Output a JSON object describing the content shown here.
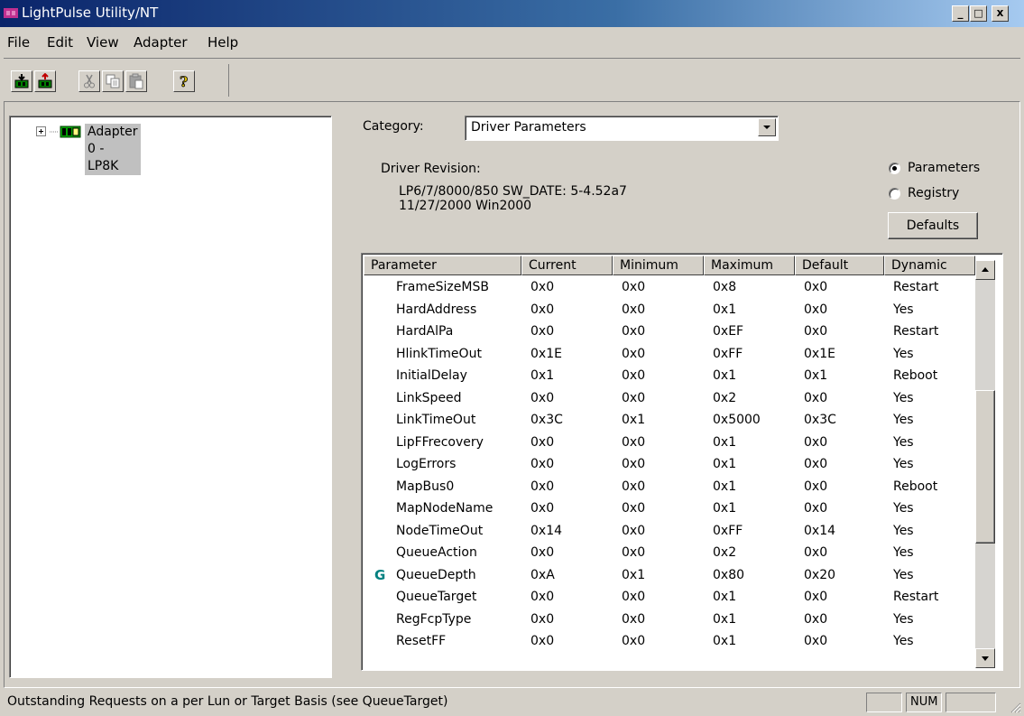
{
  "window": {
    "title": "LightPulse Utility/NT",
    "min": "_",
    "max": "□",
    "close": "x"
  },
  "menu": [
    "File",
    "Edit",
    "View",
    "Adapter",
    "Help"
  ],
  "toolbar": {
    "help_glyph": "?"
  },
  "tree": {
    "label": "Adapter 0 - LP8K"
  },
  "category": {
    "label": "Category:",
    "value": "Driver Parameters"
  },
  "driver": {
    "revision_label": "Driver Revision:",
    "line1": "LP6/7/8000/850 SW_DATE: 5-4.52a7",
    "line2": "11/27/2000 Win2000"
  },
  "options": {
    "parameters_label": "Parameters",
    "registry_label": "Registry",
    "selected": "parameters",
    "defaults_label": "Defaults"
  },
  "table": {
    "columns": [
      "Parameter",
      "Current",
      "Minimum",
      "Maximum",
      "Default",
      "Dynamic"
    ],
    "rows": [
      {
        "mark": "",
        "cells": [
          "FrameSizeMSB",
          "0x0",
          "0x0",
          "0x8",
          "0x0",
          "Restart"
        ]
      },
      {
        "mark": "",
        "cells": [
          "HardAddress",
          "0x0",
          "0x0",
          "0x1",
          "0x0",
          "Yes"
        ]
      },
      {
        "mark": "",
        "cells": [
          "HardAlPa",
          "0x0",
          "0x0",
          "0xEF",
          "0x0",
          "Restart"
        ]
      },
      {
        "mark": "",
        "cells": [
          "HlinkTimeOut",
          "0x1E",
          "0x0",
          "0xFF",
          "0x1E",
          "Yes"
        ]
      },
      {
        "mark": "",
        "cells": [
          "InitialDelay",
          "0x1",
          "0x0",
          "0x1",
          "0x1",
          "Reboot"
        ]
      },
      {
        "mark": "",
        "cells": [
          "LinkSpeed",
          "0x0",
          "0x0",
          "0x2",
          "0x0",
          "Yes"
        ]
      },
      {
        "mark": "",
        "cells": [
          "LinkTimeOut",
          "0x3C",
          "0x1",
          "0x5000",
          "0x3C",
          "Yes"
        ]
      },
      {
        "mark": "",
        "cells": [
          "LipFFrecovery",
          "0x0",
          "0x0",
          "0x1",
          "0x0",
          "Yes"
        ]
      },
      {
        "mark": "",
        "cells": [
          "LogErrors",
          "0x0",
          "0x0",
          "0x1",
          "0x0",
          "Yes"
        ]
      },
      {
        "mark": "",
        "cells": [
          "MapBus0",
          "0x0",
          "0x0",
          "0x1",
          "0x0",
          "Reboot"
        ]
      },
      {
        "mark": "",
        "cells": [
          "MapNodeName",
          "0x0",
          "0x0",
          "0x1",
          "0x0",
          "Yes"
        ]
      },
      {
        "mark": "",
        "cells": [
          "NodeTimeOut",
          "0x14",
          "0x0",
          "0xFF",
          "0x14",
          "Yes"
        ]
      },
      {
        "mark": "",
        "cells": [
          "QueueAction",
          "0x0",
          "0x0",
          "0x2",
          "0x0",
          "Yes"
        ]
      },
      {
        "mark": "G",
        "cells": [
          "QueueDepth",
          "0xA",
          "0x1",
          "0x80",
          "0x20",
          "Yes"
        ]
      },
      {
        "mark": "",
        "cells": [
          "QueueTarget",
          "0x0",
          "0x0",
          "0x1",
          "0x0",
          "Restart"
        ]
      },
      {
        "mark": "",
        "cells": [
          "RegFcpType",
          "0x0",
          "0x0",
          "0x1",
          "0x0",
          "Yes"
        ]
      },
      {
        "mark": "",
        "cells": [
          "ResetFF",
          "0x0",
          "0x0",
          "0x1",
          "0x0",
          "Yes"
        ]
      }
    ]
  },
  "status": {
    "text": "Outstanding Requests on a per Lun or Target Basis (see QueueTarget)",
    "num": "NUM"
  }
}
